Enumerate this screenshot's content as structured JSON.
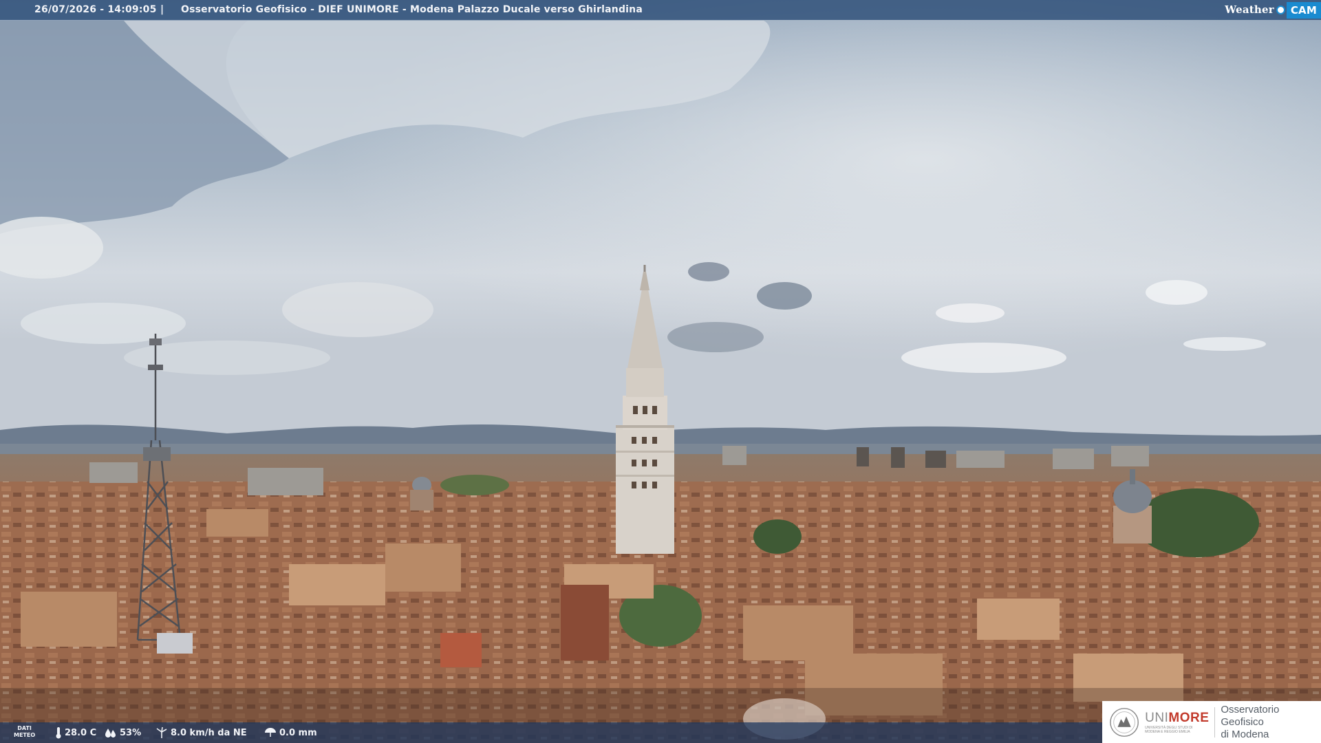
{
  "header": {
    "timestamp": "26/07/2026 - 14:09:05",
    "separator": "|",
    "title": "Osservatorio Geofisico - DIEF UNIMORE - Modena Palazzo Ducale verso Ghirlandina",
    "brand_word": "Weather",
    "brand_cam": "CAM"
  },
  "weather": {
    "label_line1": "DATI",
    "label_line2": "METEO",
    "temperature": "28.0 C",
    "humidity": "53%",
    "wind": "8.0 km/h da NE",
    "rain": "0.0 mm"
  },
  "logo": {
    "uni": "UNI",
    "more": "MORE",
    "university_line": "UNIVERSITÀ DEGLI STUDI DI MODENA E REGGIO EMILIA",
    "observatory_line1": "Osservatorio Geofisico",
    "observatory_line2": "di Modena"
  },
  "colors": {
    "bar": "#2d4e78",
    "brand_blue": "#1a8bd0",
    "unimore_red": "#c23a2b"
  }
}
